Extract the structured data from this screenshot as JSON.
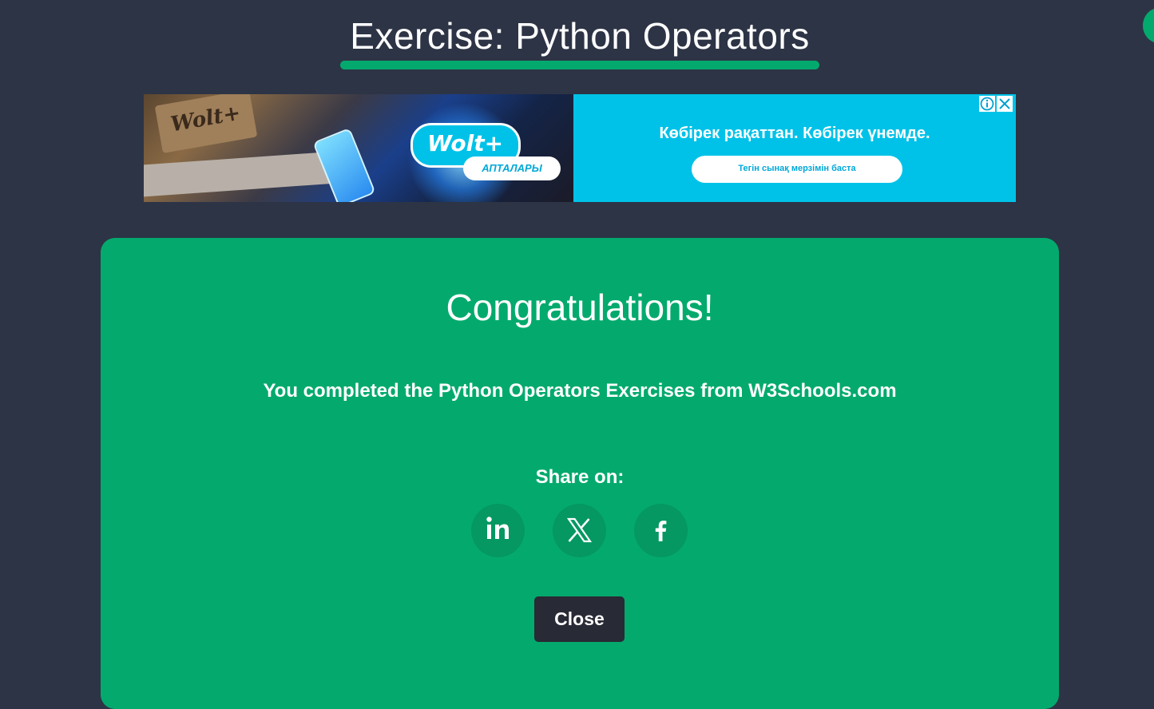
{
  "header": {
    "title": "Exercise: Python Operators"
  },
  "ad": {
    "box_brand": "Wolt+",
    "logo": "Wolt+",
    "sub_label": "АПТАЛАРЫ",
    "headline": "Көбірек рақаттан. Көбірек үнемде.",
    "cta": "Тегін сынақ мерзімін баста",
    "info_icon": "info-icon",
    "close_icon": "close-icon"
  },
  "modal": {
    "title": "Congratulations!",
    "message": "You completed the Python Operators Exercises from W3Schools.com",
    "share_label": "Share on:",
    "share_buttons": [
      {
        "icon": "linkedin-icon"
      },
      {
        "icon": "x-icon"
      },
      {
        "icon": "facebook-icon"
      }
    ],
    "close_label": "Close"
  },
  "colors": {
    "background": "#2d3446",
    "accent": "#04aa6d",
    "share_button": "#059862",
    "close_button": "#282a35",
    "ad_blue": "#00c2e8"
  }
}
